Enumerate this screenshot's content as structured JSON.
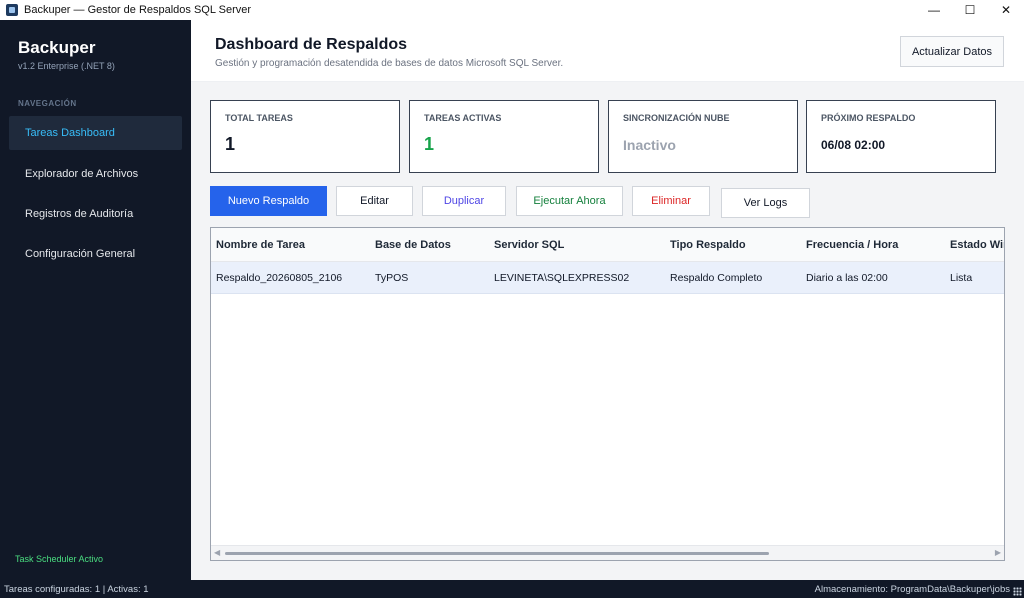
{
  "window": {
    "title": "Backuper — Gestor de Respaldos SQL Server",
    "controls": {
      "minimize": "—",
      "maximize": "☐",
      "close": "✕"
    }
  },
  "sidebar": {
    "brand": "Backuper",
    "version": "v1.2 Enterprise (.NET 8)",
    "nav_heading": "NAVEGACIÓN",
    "items": [
      {
        "label": "Tareas  Dashboard",
        "active": true
      },
      {
        "label": "Explorador de Archivos"
      },
      {
        "label": "Registros de Auditoría"
      },
      {
        "label": "Configuración General"
      }
    ],
    "scheduler_status": "Task Scheduler Activo",
    "scheduler_color": "#4ade80"
  },
  "header": {
    "title": "Dashboard de Respaldos",
    "subtitle": "Gestión y programación desatendida de bases de datos Microsoft SQL Server.",
    "refresh_label": "Actualizar Datos"
  },
  "cards": [
    {
      "label": "TOTAL TAREAS",
      "value": "1"
    },
    {
      "label": "TAREAS ACTIVAS",
      "value": "1",
      "color": "#16a34a"
    },
    {
      "label": "SINCRONIZACIÓN NUBE",
      "value": "Inactivo",
      "color": "#9ca3af"
    },
    {
      "label": "PRÓXIMO RESPALDO",
      "value": "06/08 02:00"
    }
  ],
  "toolbar": {
    "new": "Nuevo Respaldo",
    "edit": "Editar",
    "duplicate": "Duplicar",
    "run_now": "Ejecutar Ahora",
    "delete": "Eliminar",
    "logs": "Ver Logs",
    "colors": {
      "new": "#2563eb",
      "duplicate": "#4f46e5",
      "run_now": "#15803d",
      "delete": "#dc2626"
    }
  },
  "table": {
    "columns": [
      "Nombre de Tarea",
      "Base de Datos",
      "Servidor SQL",
      "Tipo Respaldo",
      "Frecuencia / Hora",
      "Estado Win"
    ],
    "rows": [
      [
        "Respaldo_20260805_2106",
        "TyPOS",
        "LEVINETA\\SQLEXPRESS02",
        "Respaldo Completo",
        "Diario a las 02:00",
        "Lista"
      ]
    ],
    "scroll_left_icon": "chevron-left-icon",
    "scroll_right_icon": "chevron-right-icon"
  },
  "statusbar": {
    "left": "Tareas configuradas: 1 | Activas: 1",
    "right": "Almacenamiento: ProgramData\\Backuper\\jobs"
  }
}
